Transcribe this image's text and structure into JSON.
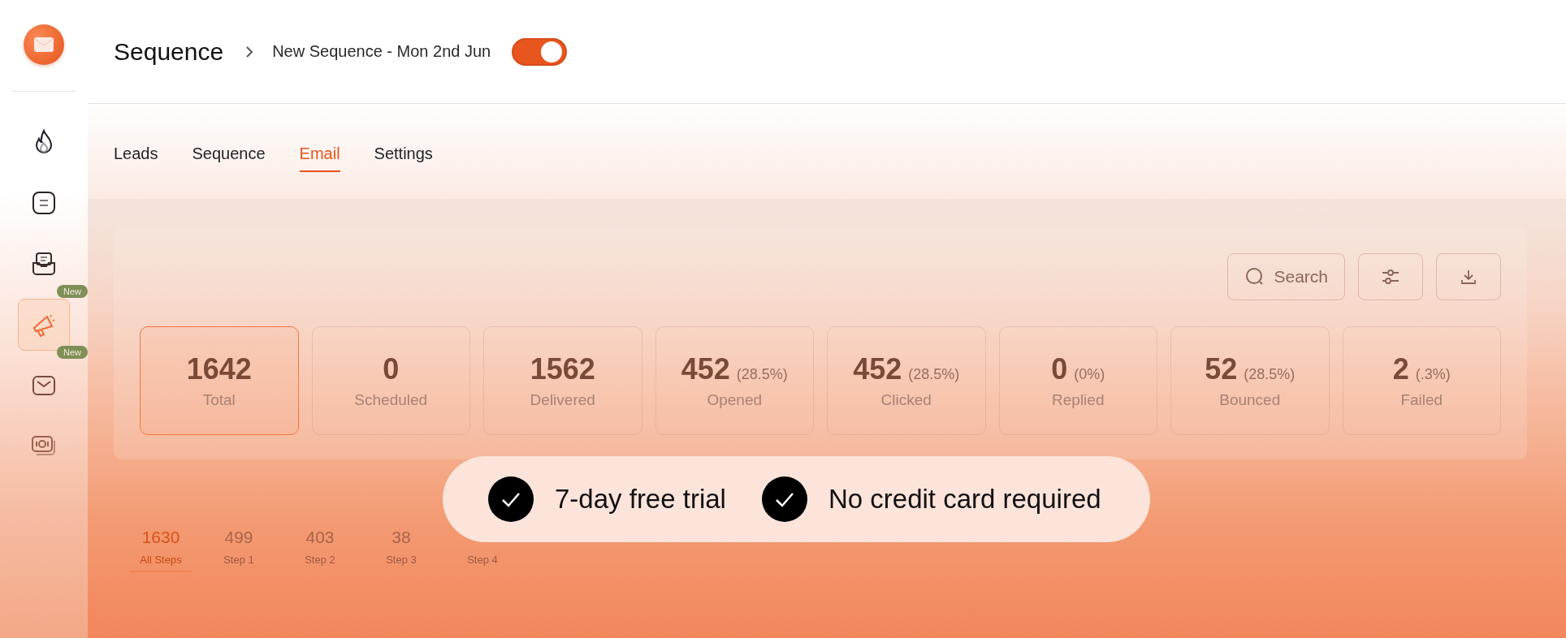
{
  "sidebar": {
    "items": [
      {
        "selected": false
      },
      {
        "selected": false
      },
      {
        "selected": false
      },
      {
        "selected": true,
        "badge": "New"
      },
      {
        "selected": false,
        "badge": "New"
      },
      {
        "selected": false
      }
    ]
  },
  "header": {
    "title": "Sequence",
    "breadcrumb": "New Sequence - Mon 2nd Jun",
    "toggle": {
      "on": true
    }
  },
  "tabs": [
    {
      "label": "Leads",
      "selected": false
    },
    {
      "label": "Sequence",
      "selected": false
    },
    {
      "label": "Email",
      "selected": true
    },
    {
      "label": "Settings",
      "selected": false
    }
  ],
  "toolbar": {
    "search": {
      "label": "Search"
    }
  },
  "stats": [
    {
      "value": "1642",
      "label": "Total",
      "selected": true
    },
    {
      "value": "0",
      "label": "Scheduled",
      "selected": false
    },
    {
      "value": "1562",
      "label": "Delivered",
      "selected": false
    },
    {
      "value": "452",
      "percent": "(28.5%)",
      "label": "Opened",
      "selected": false
    },
    {
      "value": "452",
      "percent": "(28.5%)",
      "label": "Clicked",
      "selected": false
    },
    {
      "value": "0",
      "percent": "(0%)",
      "label": "Replied",
      "selected": false
    },
    {
      "value": "52",
      "percent": "(28.5%)",
      "label": "Bounced",
      "selected": false
    },
    {
      "value": "2",
      "percent": "(.3%)",
      "label": "Failed",
      "selected": false
    }
  ],
  "steps": [
    {
      "value": "1630",
      "label": "All Steps",
      "selected": true
    },
    {
      "value": "499",
      "label": "Step 1",
      "selected": false
    },
    {
      "value": "403",
      "label": "Step 2",
      "selected": false
    },
    {
      "value": "38",
      "label": "Step 3",
      "selected": false
    },
    {
      "label": "Step 4",
      "selected": false
    }
  ],
  "promo": {
    "items": [
      "7-day free trial",
      "No credit card required"
    ]
  }
}
